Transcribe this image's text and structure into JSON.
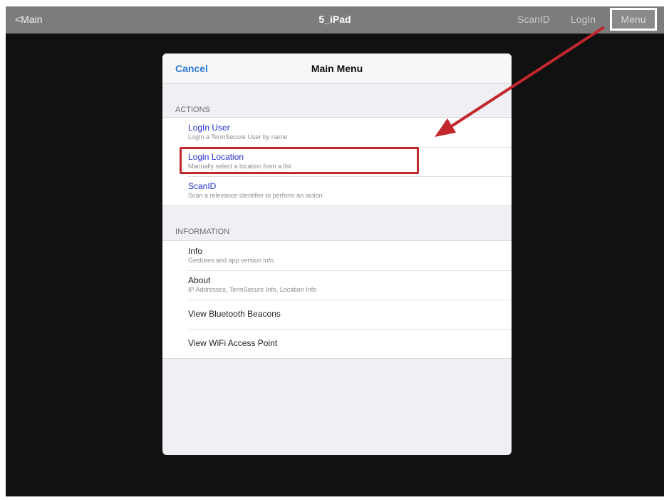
{
  "navbar": {
    "back_label": "<Main",
    "title": "5_iPad",
    "scanid_label": "ScanID",
    "login_label": "LogIn",
    "menu_label": "Menu"
  },
  "sheet": {
    "cancel_label": "Cancel",
    "title": "Main Menu",
    "actions_header": "ACTIONS",
    "actions": [
      {
        "title": "LogIn User",
        "subtitle": "LogIn a TermSecure User by name"
      },
      {
        "title": "Login Location",
        "subtitle": "Manually select a location from a list"
      },
      {
        "title": "ScanID",
        "subtitle": "Scan a relevance identifier to perform an action"
      }
    ],
    "information_header": "INFORMATION",
    "information": [
      {
        "title": "Info",
        "subtitle": "Gestures and app version info."
      },
      {
        "title": "About",
        "subtitle": "IP Addresses, TermSecure Info, Location Info"
      },
      {
        "title": "View Bluetooth Beacons"
      },
      {
        "title": "View WiFi Access Point"
      }
    ]
  },
  "annotations": {
    "highlight_color": "#c1272d",
    "arrow_color": "#c1272d"
  },
  "colors": {
    "navbar_bg": "#7c7c7c",
    "screen_bg": "#111111",
    "sheet_bg": "#efeff4",
    "link_blue": "#2233cc",
    "cancel_blue": "#2f7bd6"
  }
}
